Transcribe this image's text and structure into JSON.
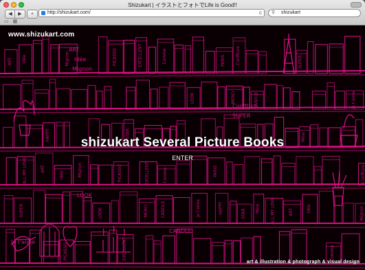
{
  "window": {
    "title": "Shizukart | イラストとフォトでLife is Good!!"
  },
  "toolbar": {
    "back_label": "◀",
    "forward_label": "▶",
    "new_tab_label": "+",
    "url": "http://shizukart.com/",
    "reload_label": "c",
    "search_value": "shizukart"
  },
  "page": {
    "site_url": "www.shizukart.com",
    "title": "shizukart Several Picture Books",
    "enter_label": "ENTER",
    "tagline": "art & illustration & photograph & visual design",
    "accent_color": "#e8138c",
    "background_color": "#0a0004",
    "doodle_words": [
      "ART",
      "Idée",
      "Mignon",
      "PICASSO",
      "EXCELLENT",
      "Comme",
      "PARIS",
      "Confiture",
      "SUPER",
      "LOOK",
      "MERCI",
      "CANDLE",
      "Je t'aime",
      "HAPPY",
      "STAR",
      "Mine",
      "ALL MY LOVE"
    ]
  }
}
